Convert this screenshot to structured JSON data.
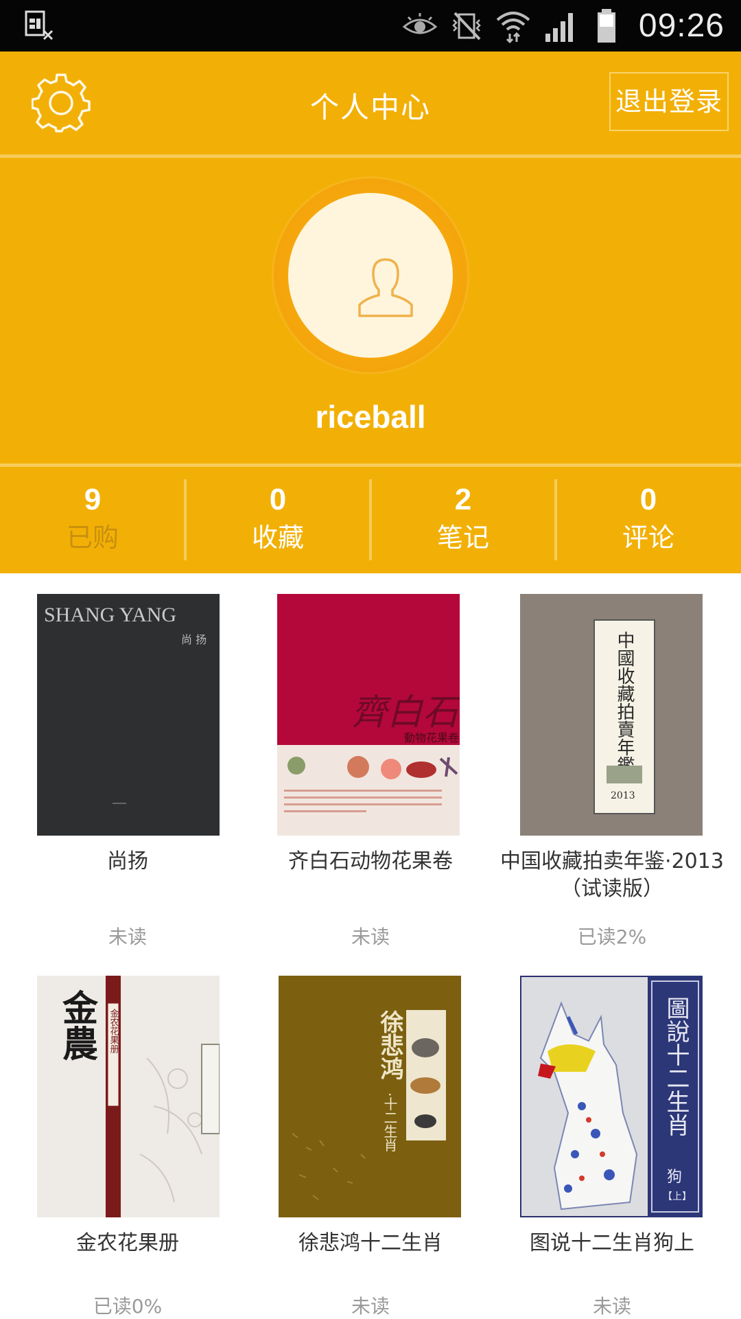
{
  "status_bar": {
    "time": "09:26",
    "icons": [
      "sim-disabled-icon",
      "eye-icon",
      "vibrate-mute-icon",
      "wifi-icon",
      "signal-icon",
      "battery-icon"
    ]
  },
  "header": {
    "title": "个人中心",
    "logout_label": "退出登录",
    "settings_icon": "gear-icon"
  },
  "profile": {
    "username": "riceball"
  },
  "stats": [
    {
      "value": "9",
      "label": "已购",
      "active": true
    },
    {
      "value": "0",
      "label": "收藏",
      "active": false
    },
    {
      "value": "2",
      "label": "笔记",
      "active": false
    },
    {
      "value": "0",
      "label": "评论",
      "active": false
    }
  ],
  "books": [
    {
      "title": "尚扬",
      "status": "未读",
      "cover_text": [
        "SHANG YANG",
        "尚 扬"
      ]
    },
    {
      "title": "齐白石动物花果卷",
      "status": "未读",
      "cover_text": [
        "齊白石",
        "動物花果卷"
      ]
    },
    {
      "title": "中国收藏拍卖年鉴·2013（试读版）",
      "status": "已读2%",
      "cover_text": [
        "中國收藏拍賣年鑑",
        "2013"
      ]
    },
    {
      "title": "金农花果册",
      "status": "已读0%",
      "cover_text": [
        "金農",
        "金农花果册"
      ]
    },
    {
      "title": "徐悲鸿十二生肖",
      "status": "未读",
      "cover_text": [
        "徐悲鸿",
        "·十二生肖"
      ]
    },
    {
      "title": "图说十二生肖狗上",
      "status": "未读",
      "cover_text": [
        "圖說十二生肖",
        "狗",
        "【上】"
      ]
    }
  ],
  "colors": {
    "brand": "#f2b006",
    "divider": "#f6cc5a",
    "avatar_ring": "#f5a70c",
    "avatar_fill": "#fff5dc"
  }
}
